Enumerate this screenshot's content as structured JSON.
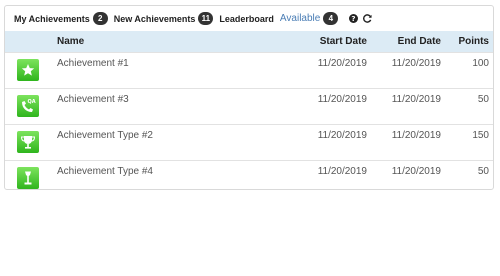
{
  "tabs": {
    "my_achievements": {
      "label": "My Achievements",
      "count": "2"
    },
    "new_achievements": {
      "label": "New Achievements",
      "count": "11"
    },
    "leaderboard": {
      "label": "Leaderboard"
    },
    "available": {
      "label": "Available",
      "count": "4"
    }
  },
  "icons": {
    "help": "question-circle-icon",
    "refresh": "refresh-icon"
  },
  "table": {
    "headers": {
      "name": "Name",
      "start": "Start Date",
      "end": "End Date",
      "points": "Points"
    },
    "rows": [
      {
        "icon": "star-icon",
        "name": "Achievement #1",
        "start": "11/20/2019",
        "end": "11/20/2019",
        "points": "100"
      },
      {
        "icon": "phone-qa-icon",
        "name": "Achievement #3",
        "start": "11/20/2019",
        "end": "11/20/2019",
        "points": "50"
      },
      {
        "icon": "trophy-icon",
        "name": "Achievement Type #2",
        "start": "11/20/2019",
        "end": "11/20/2019",
        "points": "150"
      },
      {
        "icon": "award-icon",
        "name": "Achievement Type #4",
        "start": "11/20/2019",
        "end": "11/20/2019",
        "points": "50"
      }
    ]
  },
  "colors": {
    "accent": "#4a7db5",
    "header_bg": "#dcebf5",
    "icon_green": "#3cbf24"
  }
}
